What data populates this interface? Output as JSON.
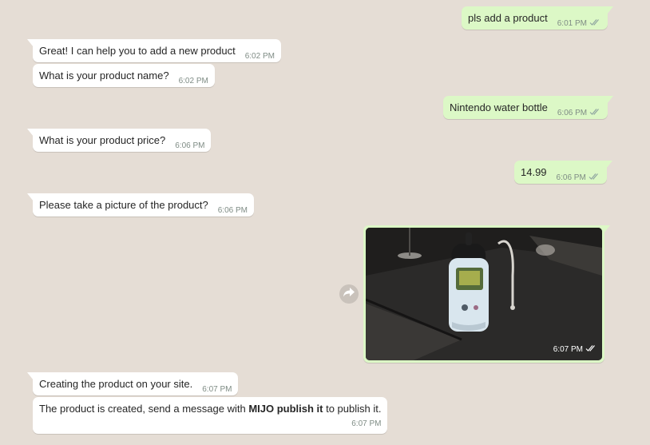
{
  "colors": {
    "chat_background": "#e5ddd5",
    "incoming_bubble": "#ffffff",
    "outgoing_bubble": "#dcf8c6",
    "timestamp": "#7f8c85"
  },
  "messages": [
    {
      "direction": "out",
      "text": "pls add a product",
      "time": "6:01 PM",
      "status": "double-check-icon"
    },
    {
      "direction": "in",
      "text": "Great! I can help you to add a new product",
      "time": "6:02 PM"
    },
    {
      "direction": "in",
      "text": "What is your product name?",
      "time": "6:02 PM"
    },
    {
      "direction": "out",
      "text": "Nintendo water bottle",
      "time": "6:06 PM",
      "status": "double-check-icon"
    },
    {
      "direction": "in",
      "text": "What is your product price?",
      "time": "6:06 PM"
    },
    {
      "direction": "out",
      "text": "14.99",
      "time": "6:06 PM",
      "status": "double-check-icon"
    },
    {
      "direction": "in",
      "text": "Please take a picture of the product?",
      "time": "6:06 PM"
    },
    {
      "direction": "out",
      "type": "image",
      "image_icon": "water-bottle-photo",
      "time": "6:07 PM",
      "status": "double-check-icon"
    },
    {
      "direction": "in",
      "text": "Creating the product on your site.",
      "time": "6:07 PM"
    },
    {
      "direction": "in",
      "text_before": "The product is created, send a message with ",
      "text_bold": "MIJO publish it",
      "text_after": " to publish it.",
      "time": "6:07 PM"
    }
  ],
  "forward_icon": "forward-arrow-icon"
}
